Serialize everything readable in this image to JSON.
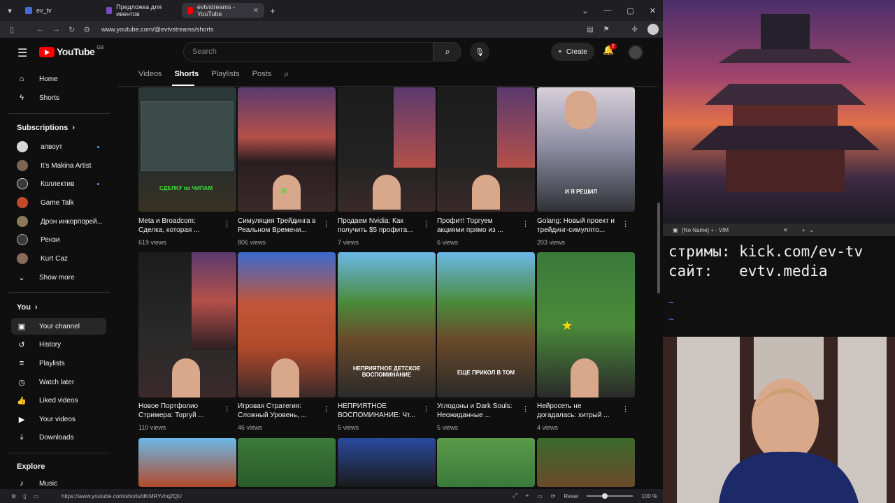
{
  "browser": {
    "tabs": [
      {
        "label": "ev_tv",
        "color": "#4a6bd6"
      },
      {
        "label": "Предложка для ивентов",
        "color": "#7a4cc9"
      },
      {
        "label": "evtvstreams - YouTube",
        "color": "#ff0000"
      }
    ],
    "tab_badge": "2",
    "url": "www.youtube.com/@evtvstreams/shorts",
    "status_url": "https://www.youtube.com/shorts/dKMRYvhqZQU",
    "zoom_reset": "Reset",
    "zoom": "100 %"
  },
  "youtube": {
    "logo_text": "YouTube",
    "country": "GB",
    "search_placeholder": "Search",
    "create_label": "Create",
    "notif_count": "2"
  },
  "sidebar": {
    "main": [
      {
        "label": "Home",
        "icon": "home-icon"
      },
      {
        "label": "Shorts",
        "icon": "shorts-icon"
      }
    ],
    "subscriptions_title": "Subscriptions",
    "subscriptions": [
      {
        "label": "апвоут",
        "color": "#d8d8d8",
        "dot": true
      },
      {
        "label": "It's Makina Artist",
        "color": "#7a6655",
        "dot": false
      },
      {
        "label": "Коллектив",
        "color": "#3a3a3a",
        "dot": true
      },
      {
        "label": "Game Talk",
        "color": "#c24a2a",
        "dot": false
      },
      {
        "label": "Дрон инкорпорей...",
        "color": "#8a7a5a",
        "dot": false
      },
      {
        "label": "Рензи",
        "color": "#3a3a3a",
        "dot": false
      },
      {
        "label": "Kurt Caz",
        "color": "#8a6a5a",
        "dot": false
      }
    ],
    "show_more": "Show more",
    "you_title": "You",
    "you": [
      {
        "label": "Your channel",
        "icon": "your-channel-icon"
      },
      {
        "label": "History",
        "icon": "history-icon"
      },
      {
        "label": "Playlists",
        "icon": "playlists-icon"
      },
      {
        "label": "Watch later",
        "icon": "watch-later-icon"
      },
      {
        "label": "Liked videos",
        "icon": "liked-videos-icon"
      },
      {
        "label": "Your videos",
        "icon": "your-videos-icon"
      },
      {
        "label": "Downloads",
        "icon": "downloads-icon"
      }
    ],
    "explore_title": "Explore",
    "explore": [
      {
        "label": "Music",
        "icon": "music-icon"
      }
    ]
  },
  "channel_tabs": [
    "Videos",
    "Shorts",
    "Playlists",
    "Posts"
  ],
  "shorts": [
    {
      "title": "Meta и Broadcom: Сделка, которая ...",
      "views": "619 views",
      "overlay": "СДЕЛКУ по ЧИПАМ"
    },
    {
      "title": "Симуляция Трейдинга в Реальном Времени...",
      "views": "806 views",
      "overlay": "И"
    },
    {
      "title": "Продаем Nvidia: Как получить $5 профита...",
      "views": "7 views",
      "overlay": ""
    },
    {
      "title": "Профит! Торгуем акциями прямо из ...",
      "views": "6 views",
      "overlay": ""
    },
    {
      "title": "Golang: Новый проект и трейдинг-симулято...",
      "views": "203 views",
      "overlay": "И Я РЕШИЛ"
    },
    {
      "title": "Новое Портфолио Стримера: Торгуй ...",
      "views": "110 views",
      "overlay": ""
    },
    {
      "title": "Игровая Стратегия: Сложный Уровень, ...",
      "views": "46 views",
      "overlay": ""
    },
    {
      "title": "НЕПРИЯТНОЕ ВОСПОМИНАНИЕ: Чт...",
      "views": "5 views",
      "overlay": "НЕПРИЯТНОЕ ДЕТСКОЕ ВОСПОМИНАНИЕ"
    },
    {
      "title": "Углодоны и Dark Souls: Неожиданные ...",
      "views": "5 views",
      "overlay": "ЕЩЕ ПРИКОЛ В ТОМ"
    },
    {
      "title": "Нейросеть не догадалась: хитрый ...",
      "views": "4 views",
      "overlay": ""
    }
  ],
  "vim": {
    "title": "[No Name] + - VIM",
    "lines": [
      "стримы: kick.com/ev-tv",
      "сайт:   evtv.media"
    ],
    "tilde": "~"
  }
}
